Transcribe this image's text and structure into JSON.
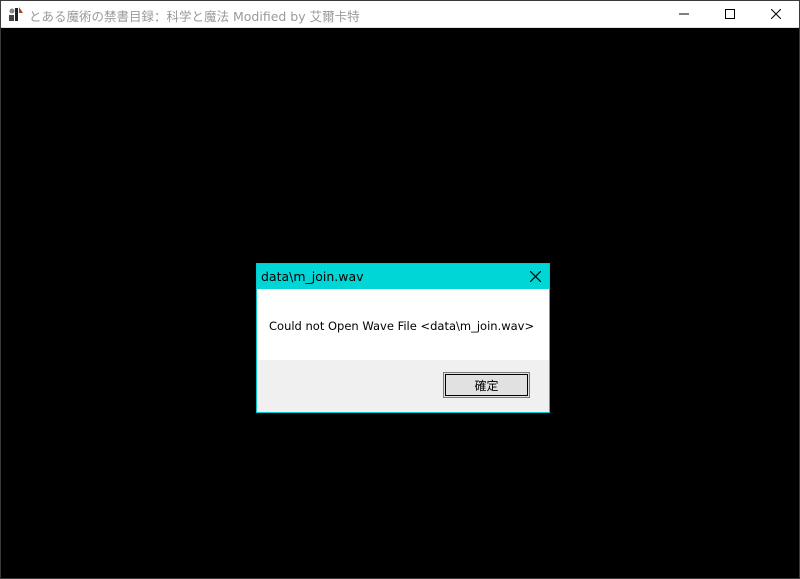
{
  "window": {
    "title": "とある魔術の禁書目録：科学と魔法 Modified by 艾爾卡特",
    "app_icon": "game-app-icon",
    "controls": {
      "minimize_icon": "minimize-icon",
      "maximize_icon": "maximize-icon",
      "close_icon": "close-icon"
    }
  },
  "dialog": {
    "title": "data\\m_join.wav",
    "message": "Could not Open Wave File <data\\m_join.wav>",
    "ok_label": "確定",
    "close_icon": "close-icon",
    "accent_color": "#00d6d6"
  }
}
